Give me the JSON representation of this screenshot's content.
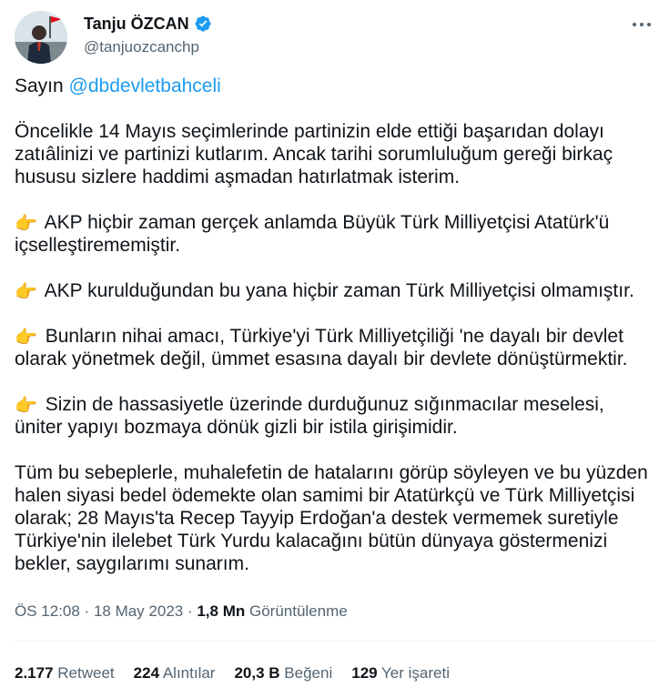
{
  "author": {
    "display_name": "Tanju ÖZCAN",
    "handle": "@tanjuozcanchp",
    "verified_color": "#1d9bf0"
  },
  "tweet": {
    "greeting_prefix": "Sayın ",
    "mention": "@dbdevletbahceli",
    "paragraph_1": "Öncelikle 14 Mayıs seçimlerinde partinizin elde ettiği başarıdan dolayı zatıâlinizi ve partinizi kutlarım. Ancak tarihi sorumluluğum gereği birkaç hususu sizlere haddimi aşmadan hatırlatmak isterim.",
    "point_icon": "👉",
    "points": [
      "AKP hiçbir zaman gerçek anlamda Büyük Türk Milliyetçisi Atatürk'ü içselleştirememiştir.",
      "AKP kurulduğundan bu yana hiçbir zaman Türk Milliyetçisi olmamıştır.",
      "Bunların nihai amacı, Türkiye'yi Türk Milliyetçiliği 'ne dayalı bir devlet olarak yönetmek değil, ümmet esasına dayalı bir devlete dönüştürmektir.",
      "Sizin de hassasiyetle üzerinde durduğunuz sığınmacılar meselesi, üniter yapıyı bozmaya dönük gizli bir istila girişimidir."
    ],
    "closing": "Tüm bu sebeplerle, muhalefetin de hatalarını görüp söyleyen ve bu yüzden halen siyasi bedel ödemekte olan samimi bir Atatürkçü ve Türk Milliyetçisi olarak; 28 Mayıs'ta Recep Tayyip Erdoğan'a destek vermemek suretiyle Türkiye'nin ilelebet Türk Yurdu kalacağını bütün dünyaya göstermenizi bekler, saygılarımı sunarım."
  },
  "meta": {
    "time": "ÖS 12:08",
    "separator": " · ",
    "date": "18 May 2023",
    "views_count": "1,8 Mn",
    "views_label": "Görüntülenme"
  },
  "stats": {
    "retweets": {
      "count": "2.177",
      "label": "Retweet"
    },
    "quotes": {
      "count": "224",
      "label": "Alıntılar"
    },
    "likes": {
      "count": "20,3 B",
      "label": "Beğeni"
    },
    "bookmarks": {
      "count": "129",
      "label": "Yer işareti"
    }
  }
}
